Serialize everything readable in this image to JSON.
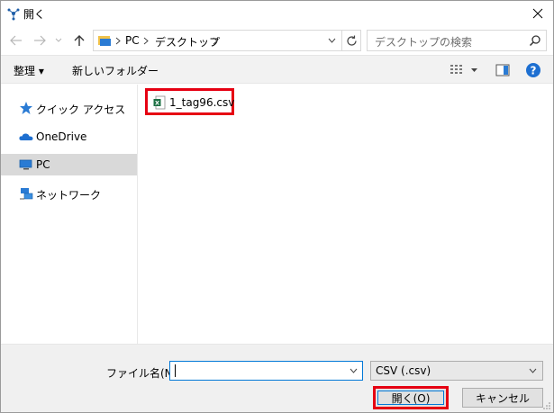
{
  "window": {
    "title": "開く"
  },
  "nav": {
    "breadcrumb": [
      "PC",
      "デスクトップ"
    ],
    "search_placeholder": "デスクトップの検索"
  },
  "toolbar": {
    "organize_label": "整理 ▾",
    "new_folder_label": "新しいフォルダー"
  },
  "sidebar": {
    "items": [
      {
        "label": "クイック アクセス",
        "icon": "star-icon"
      },
      {
        "label": "OneDrive",
        "icon": "cloud-icon"
      },
      {
        "label": "PC",
        "icon": "computer-icon",
        "selected": true
      },
      {
        "label": "ネットワーク",
        "icon": "network-icon"
      }
    ]
  },
  "files": [
    {
      "name": "1_tag96.csv",
      "icon": "excel-file-icon"
    }
  ],
  "bottom": {
    "filename_label": "ファイル名(N):",
    "filename_value": "",
    "filetype_value": "CSV (.csv)",
    "open_label": "開く(O)",
    "cancel_label": "キャンセル"
  },
  "colors": {
    "highlight_red": "#e60012",
    "focus_blue": "#0078d7",
    "excel_green": "#1d7044"
  }
}
